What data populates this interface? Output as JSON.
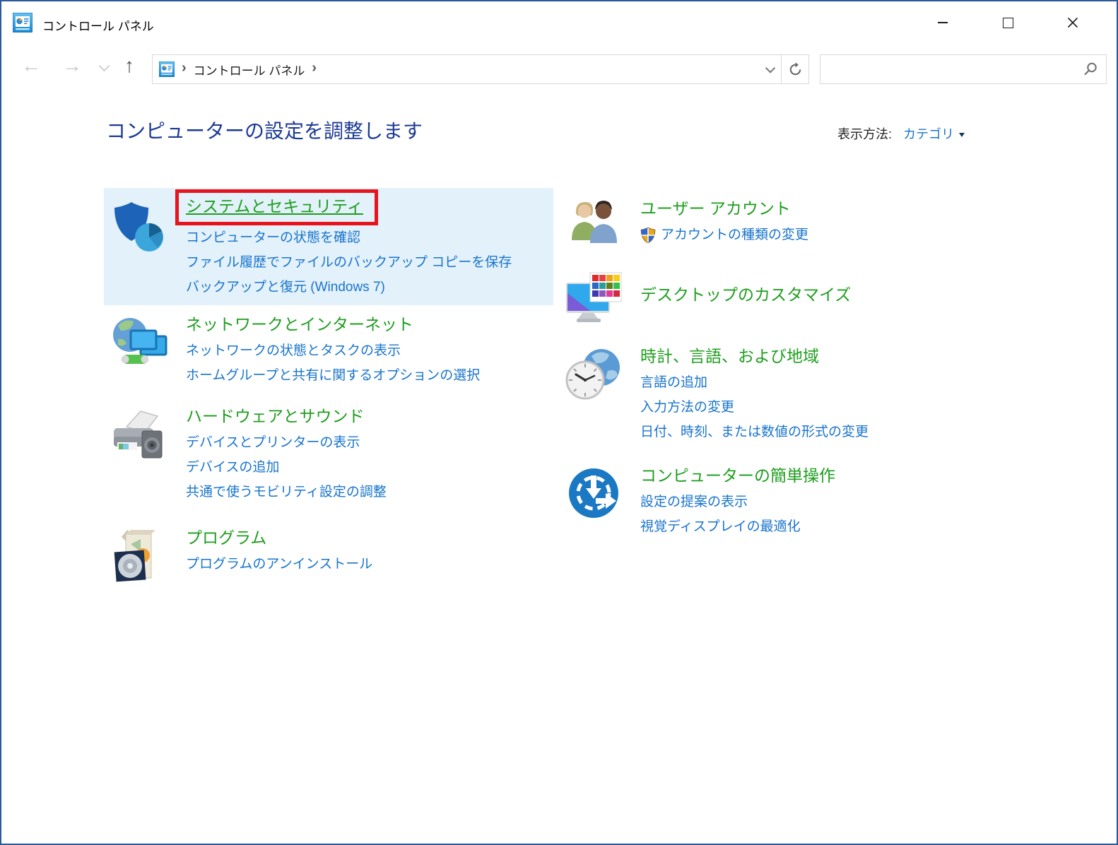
{
  "window": {
    "title": "コントロール パネル"
  },
  "icons": {
    "app_icon": "control-panel-icon",
    "back": "←",
    "forward": "→",
    "up": "↑",
    "breadcrumb_chevron": "›",
    "refresh": "refresh-circular-arrow-icon",
    "search": "magnifier-icon",
    "uac_shield": "uac-security-shield-icon"
  },
  "navbar": {
    "breadcrumb_root": "コントロール パネル"
  },
  "header": {
    "title": "コンピューターの設定を調整します",
    "view_by_label": "表示方法:",
    "view_by_value": "カテゴリ"
  },
  "categories": {
    "left": [
      {
        "title": "システムとセキュリティ",
        "icon": "security-shield-pie-icon",
        "highlighted": true,
        "red_annotation": true,
        "links": [
          "コンピューターの状態を確認",
          "ファイル履歴でファイルのバックアップ コピーを保存",
          "バックアップと復元 (Windows 7)"
        ]
      },
      {
        "title": "ネットワークとインターネット",
        "icon": "network-globe-monitors-icon",
        "links": [
          "ネットワークの状態とタスクの表示",
          "ホームグループと共有に関するオプションの選択"
        ]
      },
      {
        "title": "ハードウェアとサウンド",
        "icon": "printer-speaker-icon",
        "links": [
          "デバイスとプリンターの表示",
          "デバイスの追加",
          "共通で使うモビリティ設定の調整"
        ]
      },
      {
        "title": "プログラム",
        "icon": "software-box-cd-icon",
        "links": [
          "プログラムのアンインストール"
        ]
      }
    ],
    "right": [
      {
        "title": "ユーザー アカウント",
        "icon": "two-users-icon",
        "links": [
          "アカウントの種類の変更"
        ]
      },
      {
        "title": "デスクトップのカスタマイズ",
        "icon": "monitor-color-palette-icon",
        "links": []
      },
      {
        "title": "時計、言語、および地域",
        "icon": "clock-globe-icon",
        "links": [
          "言語の追加",
          "入力方法の変更",
          "日付、時刻、または数値の形式の変更"
        ]
      },
      {
        "title": "コンピューターの簡単操作",
        "icon": "ease-of-access-icon",
        "links": [
          "設定の提案の表示",
          "視覚ディスプレイの最適化"
        ]
      }
    ]
  },
  "colors": {
    "category_title_green": "#1f9e1f",
    "task_link_blue": "#1874cd",
    "page_title_navy": "#1c3a94",
    "highlight_bg": "#e3f1fb",
    "red_annotation": "#e8141d",
    "window_border": "#2a5a9e"
  }
}
